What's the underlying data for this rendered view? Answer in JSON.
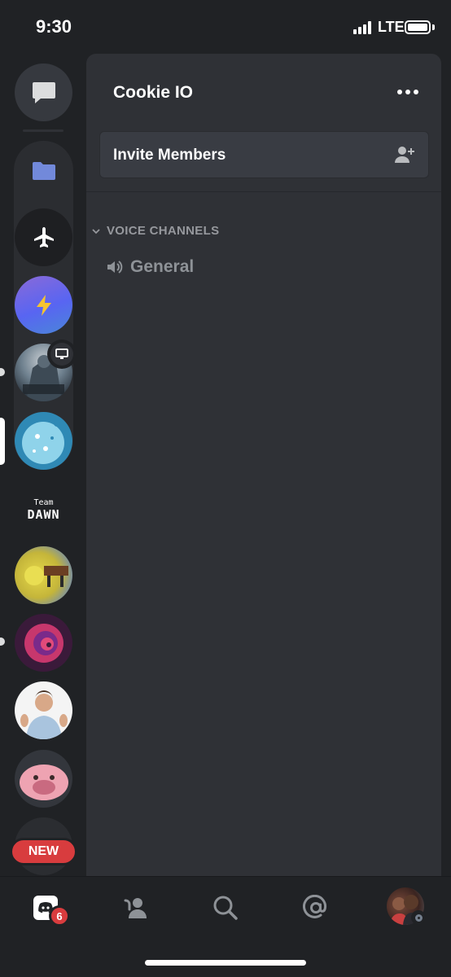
{
  "status_bar": {
    "time": "9:30",
    "network": "LTE"
  },
  "server_rail": {
    "team_server_line1": "Team",
    "team_server_line2": "DAWN",
    "new_badge": "NEW"
  },
  "channel_panel": {
    "guild_name": "Cookie IO",
    "invite_label": "Invite Members",
    "category_label": "VOICE CHANNELS",
    "channels": [
      {
        "name": "General",
        "type": "voice"
      }
    ]
  },
  "bottom_nav": {
    "home_badge_count": "6",
    "items": [
      "home-icon",
      "friends-icon",
      "search-icon",
      "mentions-icon",
      "profile-avatar"
    ]
  },
  "colors": {
    "background": "#202225",
    "panel": "#2f3136",
    "accent": "#5865f2",
    "danger": "#d83c3e",
    "muted_text": "#8e9297"
  }
}
